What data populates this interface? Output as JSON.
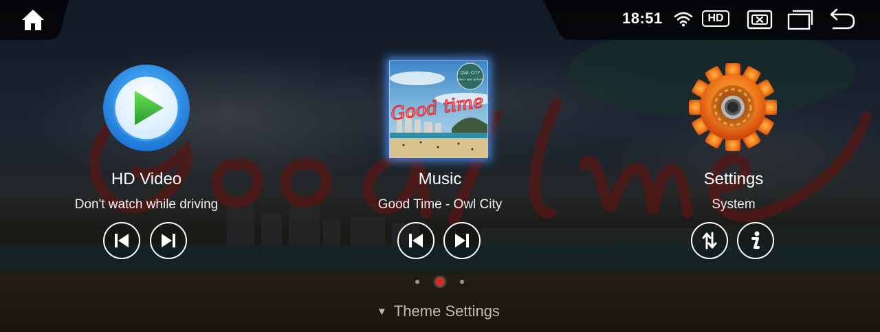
{
  "status": {
    "time": "18:51",
    "hd_badge": "HD"
  },
  "icons": {
    "home": "home-icon",
    "wifi": "wifi-icon",
    "close_window": "close-window-icon",
    "multi_window": "multi-window-icon",
    "back": "back-icon",
    "play": "play-icon",
    "gear": "gear-icon",
    "prev": "skip-previous-icon",
    "next": "skip-next-icon",
    "sort": "sort-icon",
    "info": "info-icon"
  },
  "tiles": {
    "video": {
      "title": "HD Video",
      "subtitle": "Don't watch while driving"
    },
    "music": {
      "title": "Music",
      "subtitle": "Good Time - Owl City"
    },
    "settings": {
      "title": "Settings",
      "subtitle": "System"
    }
  },
  "album_art": {
    "script_text": "Good time",
    "badge_line1": "OWL CITY",
    "badge_line2": "CARLY RAE JEPSEN"
  },
  "pager": {
    "page_count": 3,
    "active_index": 1
  },
  "theme_settings": {
    "label": "Theme Settings"
  },
  "colors": {
    "accent_blue": "#2a8ff0",
    "play_green": "#3dbb3a",
    "gear_orange": "#f07a1a",
    "active_dot": "#e02424"
  }
}
